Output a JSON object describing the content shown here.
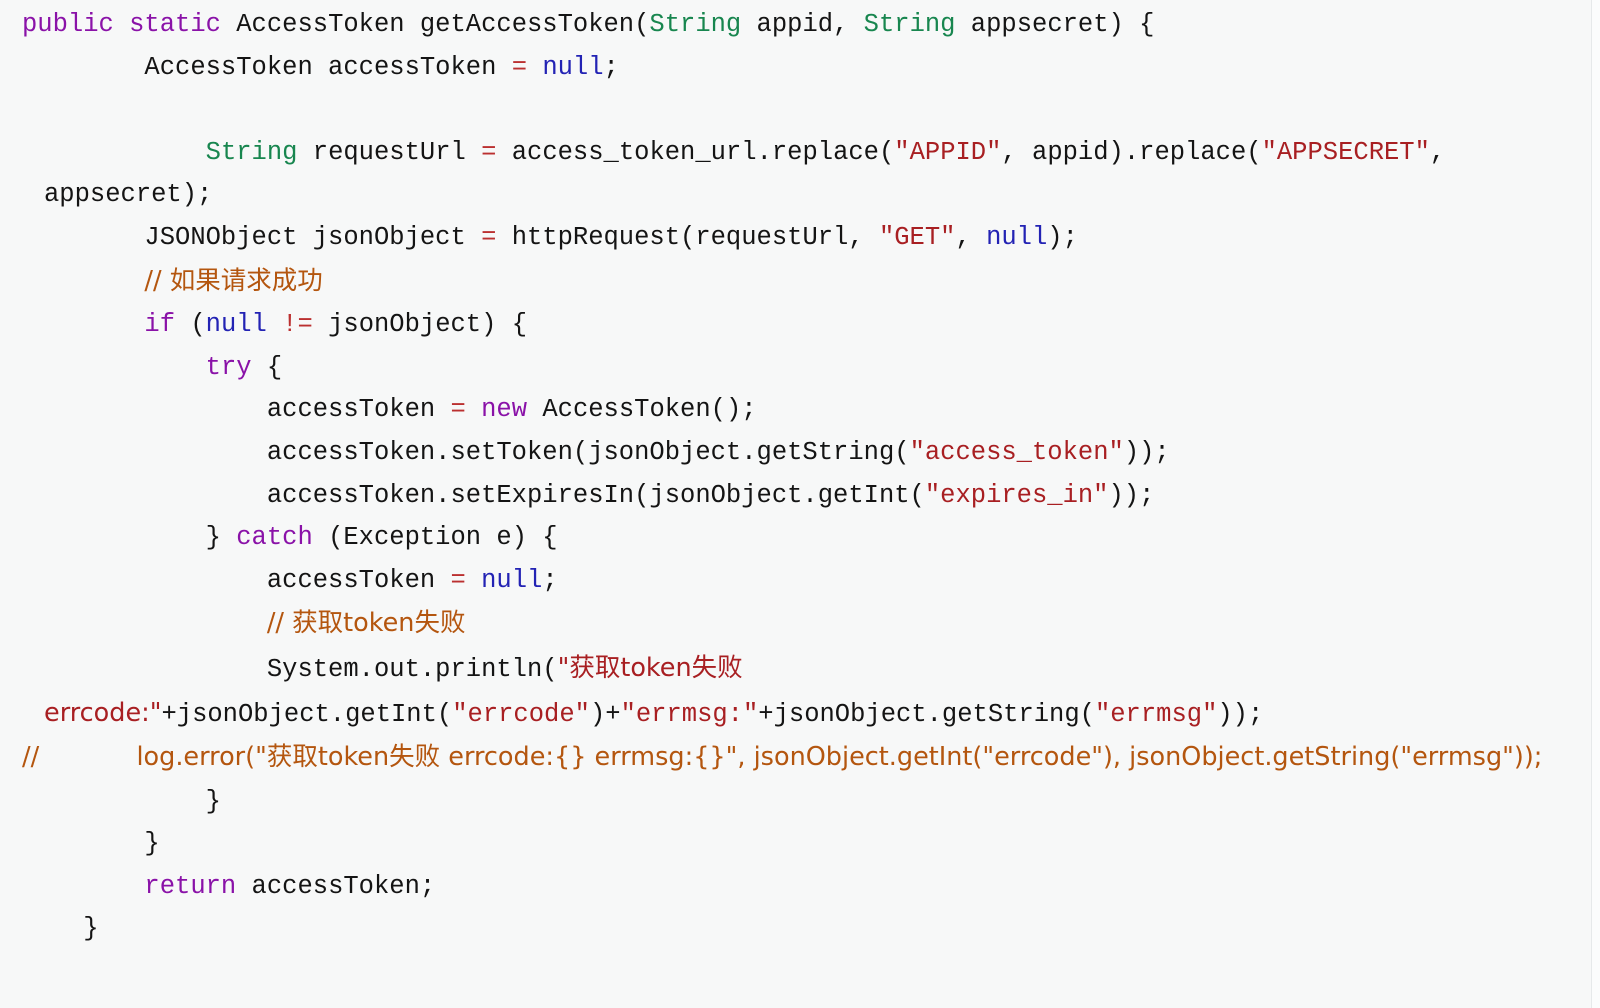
{
  "view": {
    "kind": "code-snippet",
    "language": "Java",
    "background_color": "#f7f8f8",
    "text_color": "#141414"
  },
  "syntax_colors": {
    "keyword": "#8a12a8",
    "type": "#18864f",
    "string": "#a81f22",
    "null_literal": "#2323b4",
    "operator": "#bb3030",
    "comment": "#b4560f",
    "plain": "#141414"
  },
  "code": {
    "line_01": {
      "t1": "public static ",
      "t2": "AccessToken getAccessToken(",
      "t3": "String",
      "t4": " appid, ",
      "t5": "String",
      "t6": " appsecret) {"
    },
    "line_02": {
      "t1": "        AccessToken accessToken ",
      "t2": "=",
      "t3": " ",
      "t4": "null",
      "t5": ";"
    },
    "line_03": {
      "t1": ""
    },
    "line_04": {
      "t1": "            ",
      "t2": "String",
      "t3": " requestUrl ",
      "t4": "=",
      "t5": " access_token_url.replace(",
      "t6": "\"APPID\"",
      "t7": ", appid).replace(",
      "t8": "\"APPSECRET\"",
      "t9": ", appsecret);"
    },
    "line_05": {
      "t1": "        JSONObject jsonObject ",
      "t2": "=",
      "t3": " httpRequest(requestUrl, ",
      "t4": "\"GET\"",
      "t5": ", ",
      "t6": "null",
      "t7": ");"
    },
    "line_06": {
      "t1": "        ",
      "t2": "// 如果请求成功"
    },
    "line_07": {
      "t1": "        ",
      "t2": "if",
      "t3": " (",
      "t4": "null",
      "t5": " ",
      "t6": "!=",
      "t7": " jsonObject) {"
    },
    "line_08": {
      "t1": "            ",
      "t2": "try",
      "t3": " {"
    },
    "line_09": {
      "t1": "                accessToken ",
      "t2": "=",
      "t3": " ",
      "t4": "new",
      "t5": " AccessToken();"
    },
    "line_10": {
      "t1": "                accessToken.setToken(jsonObject.getString(",
      "t2": "\"access_token\"",
      "t3": "));"
    },
    "line_11": {
      "t1": "                accessToken.setExpiresIn(jsonObject.getInt(",
      "t2": "\"expires_in\"",
      "t3": "));"
    },
    "line_12": {
      "t1": "            } ",
      "t2": "catch",
      "t3": " (Exception e) {"
    },
    "line_13": {
      "t1": "                accessToken ",
      "t2": "=",
      "t3": " ",
      "t4": "null",
      "t5": ";"
    },
    "line_14": {
      "t1": "                ",
      "t2": "// 获取token失败"
    },
    "line_15": {
      "t1": "                System.out.println(",
      "t2": "\"获取token失败 errcode:\"",
      "t3": "+jsonObject.getInt(",
      "t4": "\"errcode\"",
      "t5": ")+",
      "t6": "\"errmsg:\"",
      "t7": "+jsonObject.getString(",
      "t8": "\"errmsg\"",
      "t9": "));"
    },
    "line_16": {
      "t1": "//            log.error(\"获取token失败 errcode:{} errmsg:{}\", jsonObject.getInt(\"errcode\"), jsonObject.getString(\"errmsg\"));"
    },
    "line_17": {
      "t1": "            }"
    },
    "line_18": {
      "t1": "        }"
    },
    "line_19": {
      "t1": "        ",
      "t2": "return",
      "t3": " accessToken;"
    },
    "line_20": {
      "t1": "    }"
    }
  }
}
